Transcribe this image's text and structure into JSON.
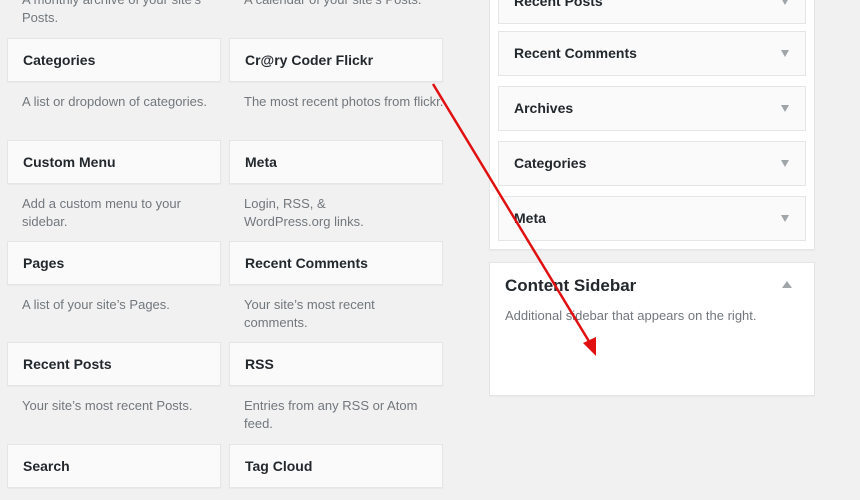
{
  "available_widgets": {
    "top_descriptions": [
      "A monthly archive of your site’s Posts.",
      "A calendar of your site’s Posts."
    ],
    "items": [
      {
        "title": "Categories",
        "desc": "A list or dropdown of categories."
      },
      {
        "title": "Cr@ry Coder Flickr",
        "desc": "The most recent photos from flickr."
      },
      {
        "title": "Custom Menu",
        "desc": "Add a custom menu to your sidebar."
      },
      {
        "title": "Meta",
        "desc": "Login, RSS, & WordPress.org links."
      },
      {
        "title": "Pages",
        "desc": "A list of your site’s Pages."
      },
      {
        "title": "Recent Comments",
        "desc": "Your site’s most recent comments."
      },
      {
        "title": "Recent Posts",
        "desc": "Your site’s most recent Posts."
      },
      {
        "title": "RSS",
        "desc": "Entries from any RSS or Atom feed."
      },
      {
        "title": "Search",
        "desc": ""
      },
      {
        "title": "Tag Cloud",
        "desc": ""
      }
    ]
  },
  "primary_sidebar": {
    "widgets": [
      "Recent Posts",
      "Recent Comments",
      "Archives",
      "Categories",
      "Meta"
    ]
  },
  "content_sidebar": {
    "title": "Content Sidebar",
    "description": "Additional sidebar that appears on the right."
  },
  "annotation": {
    "color": "#e01010"
  }
}
